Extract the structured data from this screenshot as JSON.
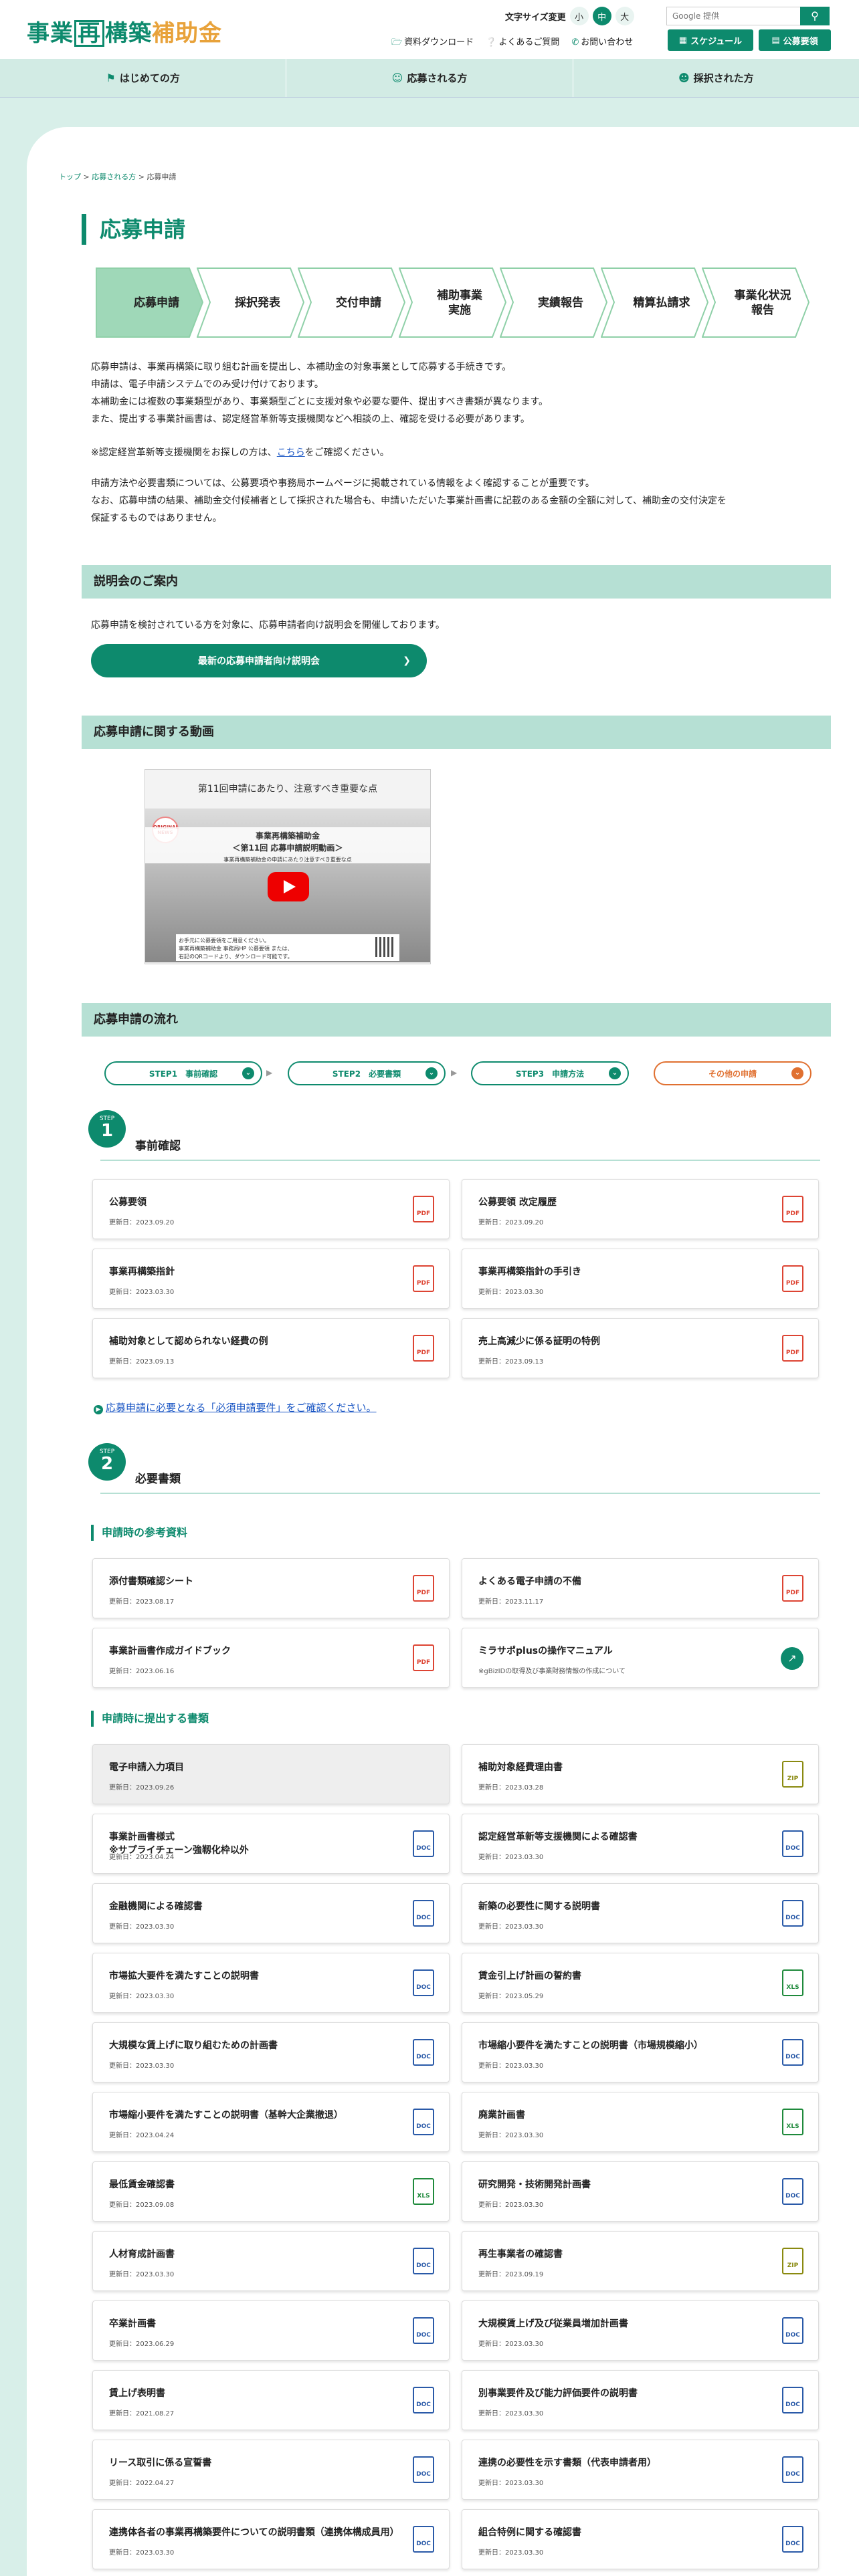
{
  "header": {
    "logo": {
      "part1": "事業",
      "part2": "再",
      "part3": "構築",
      "part4": "補助金"
    },
    "font_size": {
      "label": "文字サイズ変更",
      "small": "小",
      "medium": "中",
      "large": "大"
    },
    "search": {
      "placeholder": "Google 提供",
      "button_icon": "search-icon"
    },
    "util_links": {
      "download": "資料ダウンロード",
      "faq": "よくあるご質問",
      "contact": "お問い合わせ"
    },
    "schedule_btn": "スケジュール",
    "public_btn": "公募要領"
  },
  "nav": {
    "beginner": "はじめての方",
    "applicant": "応募される方",
    "adopted": "採択された方"
  },
  "breadcrumb": {
    "top": "トップ",
    "applicant": "応募される方",
    "current": "応募申請"
  },
  "page_title": "応募申請",
  "flow_steps": [
    "応募申請",
    "採択発表",
    "交付申請",
    "補助事業\n実施",
    "実績報告",
    "精算払請求",
    "事業化状況\n報告"
  ],
  "intro": {
    "l1": "応募申請は、事業再構築に取り組む計画を提出し、本補助金の対象事業として応募する手続きです。",
    "l2": "申請は、電子申請システムでのみ受け付けております。",
    "l3": "本補助金には複数の事業類型があり、事業類型ごとに支援対象や必要な要件、提出すべき書類が異なります。",
    "l4": "また、提出する事業計画書は、認定経営革新等支援機関などへ相談の上、確認を受ける必要があります。",
    "l5a": "※認定経営革新等支援機関をお探しの方は、",
    "l5link": "こちら",
    "l5b": "をご確認ください。",
    "l6": "申請方法や必要書類については、公募要項や事務局ホームページに掲載されている情報をよく確認することが重要です。",
    "l7": "なお、応募申請の結果、補助金交付候補者として採択された場合も、申請いただいた事業計画書に記載のある金額の全額に対して、補助金の交付決定を",
    "l8": "保証するものではありません。"
  },
  "briefing": {
    "heading": "説明会のご案内",
    "text": "応募申請を検討されている方を対象に、応募申請者向け説明会を開催しております。",
    "button": "最新の応募申請者向け説明会"
  },
  "video": {
    "heading": "応募申請に関する動画",
    "title": "第11回申請にあたり、注意すべき重要な点",
    "banner1": "事業再構築補助金",
    "banner2": "＜第11回 応募申請説明動画＞",
    "banner3": "事業再構築補助金の申請にあたり注意すべき重要な点",
    "foot1": "お手元に公募要領をご用意ください。",
    "foot2": "事業再構築補助金 事務局HP 公募要領 または、",
    "foot3": "右記のQRコードより、ダウンロード可能です。",
    "badge": "ORIGINAL NEWS"
  },
  "flow": {
    "heading": "応募申請の流れ",
    "step1": "STEP1　事前確認",
    "step2": "STEP2　必要書類",
    "step3": "STEP3　申請方法",
    "other": "その他の申請"
  },
  "step1": {
    "badge_t": "STEP",
    "badge_n": "1",
    "title": "事前確認",
    "cards": [
      {
        "title": "公募要領",
        "date": "更新日：2023.09.20",
        "type": "PDF"
      },
      {
        "title": "公募要領 改定履歴",
        "date": "更新日：2023.09.20",
        "type": "PDF"
      },
      {
        "title": "事業再構築指針",
        "date": "更新日：2023.03.30",
        "type": "PDF"
      },
      {
        "title": "事業再構築指針の手引き",
        "date": "更新日：2023.03.30",
        "type": "PDF"
      },
      {
        "title": "補助対象として認められない経費の例",
        "date": "更新日：2023.09.13",
        "type": "PDF"
      },
      {
        "title": "売上高減少に係る証明の特例",
        "date": "更新日：2023.09.13",
        "type": "PDF"
      }
    ],
    "req_link": "応募申請に必要となる「必須申請要件」をご確認ください。"
  },
  "step2": {
    "badge_t": "STEP",
    "badge_n": "2",
    "title": "必要書類",
    "ref_heading": "申請時の参考資料",
    "ref_cards": [
      {
        "title": "添付書類確認シート",
        "date": "更新日：2023.08.17",
        "type": "PDF"
      },
      {
        "title": "よくある電子申請の不備",
        "date": "更新日：2023.11.17",
        "type": "PDF"
      },
      {
        "title": "事業計画書作成ガイドブック",
        "date": "更新日：2023.06.16",
        "type": "PDF"
      },
      {
        "title": "ミラサポplusの操作マニュアル",
        "date": "※gBizIDの取得及び事業財務情報の作成について",
        "type": "EXT"
      }
    ],
    "sub_heading": "申請時に提出する書類",
    "sub_cards": [
      {
        "title": "電子申請入力項目",
        "date": "更新日：2023.09.26",
        "type": ""
      },
      {
        "title": "補助対象経費理由書",
        "date": "更新日：2023.03.28",
        "type": "ZIP"
      },
      {
        "title": "事業計画書様式\n※サプライチェーン強靱化枠以外",
        "date": "更新日：2023.04.24",
        "type": "DOC"
      },
      {
        "title": "認定経営革新等支援機関による確認書",
        "date": "更新日：2023.03.30",
        "type": "DOC"
      },
      {
        "title": "金融機関による確認書",
        "date": "更新日：2023.03.30",
        "type": "DOC"
      },
      {
        "title": "新築の必要性に関する説明書",
        "date": "更新日：2023.03.30",
        "type": "DOC"
      },
      {
        "title": "市場拡大要件を満たすことの説明書",
        "date": "更新日：2023.03.30",
        "type": "DOC"
      },
      {
        "title": "賃金引上げ計画の誓約書",
        "date": "更新日：2023.05.29",
        "type": "XLS"
      },
      {
        "title": "大規模な賃上げに取り組むための計画書",
        "date": "更新日：2023.03.30",
        "type": "DOC"
      },
      {
        "title": "市場縮小要件を満たすことの説明書（市場規模縮小）",
        "date": "更新日：2023.03.30",
        "type": "DOC"
      },
      {
        "title": "市場縮小要件を満たすことの説明書（基幹大企業撤退）",
        "date": "更新日：2023.04.24",
        "type": "DOC"
      },
      {
        "title": "廃業計画書",
        "date": "更新日：2023.03.30",
        "type": "XLS"
      },
      {
        "title": "最低賃金確認書",
        "date": "更新日：2023.09.08",
        "type": "XLS"
      },
      {
        "title": "研究開発・技術開発計画書",
        "date": "更新日：2023.03.30",
        "type": "DOC"
      },
      {
        "title": "人材育成計画書",
        "date": "更新日：2023.03.30",
        "type": "DOC"
      },
      {
        "title": "再生事業者の確認書",
        "date": "更新日：2023.09.19",
        "type": "ZIP"
      },
      {
        "title": "卒業計画書",
        "date": "更新日：2023.06.29",
        "type": "DOC"
      },
      {
        "title": "大規模賃上げ及び従業員増加計画書",
        "date": "更新日：2023.03.30",
        "type": "DOC"
      },
      {
        "title": "賃上げ表明書",
        "date": "更新日：2021.08.27",
        "type": "DOC"
      },
      {
        "title": "別事業要件及び能力評価要件の説明書",
        "date": "更新日：2023.03.30",
        "type": "DOC"
      },
      {
        "title": "リース取引に係る宣誓書",
        "date": "更新日：2022.04.27",
        "type": "DOC"
      },
      {
        "title": "連携の必要性を示す書類（代表申請者用）",
        "date": "更新日：2023.03.30",
        "type": "DOC"
      },
      {
        "title": "連携体各者の事業再構築要件についての説明書類（連携体構成員用）",
        "date": "更新日：2023.03.30",
        "type": "DOC"
      },
      {
        "title": "組合特例に関する確認書",
        "date": "更新日：2023.03.30",
        "type": "DOC"
      }
    ]
  },
  "colors": {
    "brand": "#0d8a6d",
    "accent": "#e8a23a",
    "section_bg": "#b6e0d4"
  }
}
